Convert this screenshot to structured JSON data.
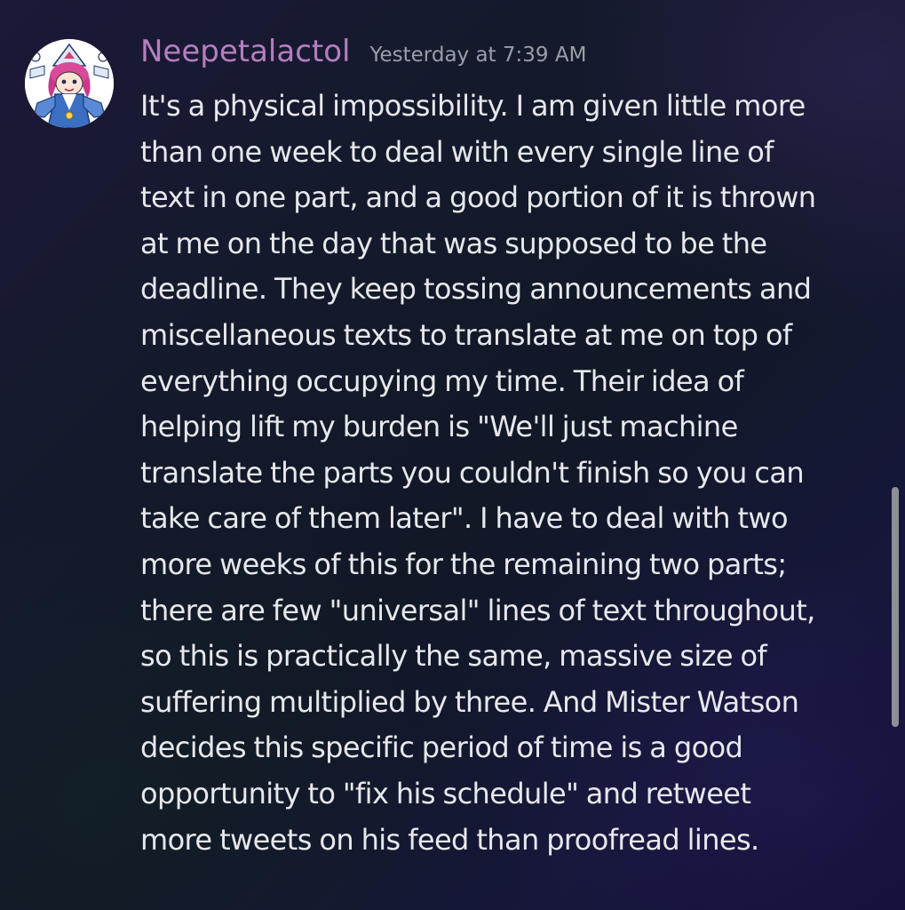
{
  "message": {
    "author": "Neepetalactol",
    "timestamp": "Yesterday at 7:39 AM",
    "avatar_icon": "user-avatar-anime-character",
    "author_color": "#b47fbf",
    "lines": [
      "It's a physical impossibility. I am given little more",
      "than one week to deal with every single line of",
      "text in one part, and a good portion of it is thrown",
      "at me on the day that was supposed to be the",
      "deadline. They keep tossing announcements and",
      "miscellaneous texts to translate at me on top of",
      "everything occupying my time. Their idea of",
      "helping lift my burden is \"We'll just machine",
      "translate the parts you couldn't finish so you can",
      "take care of them later\". I have to deal with two",
      "more weeks of this for the remaining two parts;",
      "there are few \"universal\" lines of text throughout,",
      "so this is practically the same, massive size of",
      "suffering multiplied by three. And Mister Watson",
      "decides this specific period of time is a good",
      "opportunity to \"fix his schedule\" and retweet",
      "more tweets on his feed than proofread lines."
    ]
  }
}
